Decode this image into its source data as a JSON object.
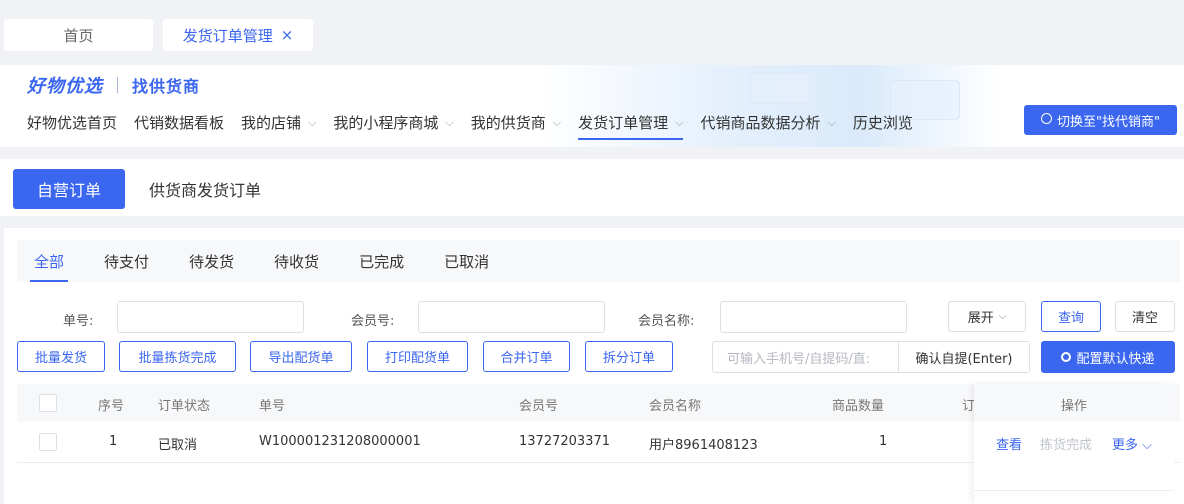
{
  "tabs": {
    "home": "首页",
    "active": "发货订单管理",
    "close": "×"
  },
  "brand": {
    "logo": "好物优选",
    "sub": "找供货商"
  },
  "nav": [
    {
      "label": "好物优选首页",
      "chevron": ""
    },
    {
      "label": "代销数据看板",
      "chevron": ""
    },
    {
      "label": "我的店铺",
      "chevron": "⌵"
    },
    {
      "label": "我的小程序商城",
      "chevron": "⌵"
    },
    {
      "label": "我的供货商",
      "chevron": "⌵"
    },
    {
      "label": "发货订单管理",
      "chevron": "⌵"
    },
    {
      "label": "代销商品数据分析",
      "chevron": "⌵"
    },
    {
      "label": "历史浏览",
      "chevron": ""
    }
  ],
  "switch_button": "切换至\"找代销商\"",
  "order_types": {
    "self": "自营订单",
    "supplier": "供货商发货订单"
  },
  "status_tabs": [
    "全部",
    "待支付",
    "待发货",
    "待收货",
    "已完成",
    "已取消"
  ],
  "filters": {
    "order_no_label": "单号:",
    "member_no_label": "会员号:",
    "member_name_label": "会员名称:",
    "expand": "展开",
    "query": "查询",
    "clear": "清空"
  },
  "actions": {
    "batch_ship": "批量发货",
    "batch_pick": "批量拣货完成",
    "export": "导出配货单",
    "print": "打印配货单",
    "merge": "合并订单",
    "split": "拆分订单",
    "scan_placeholder": "可输入手机号/自提码/直:",
    "confirm_pickup": "确认自提(Enter)",
    "config_express": "配置默认快递"
  },
  "table": {
    "headers": {
      "seq": "序号",
      "status": "订单状态",
      "order_no": "单号",
      "member_no": "会员号",
      "member_name": "会员名称",
      "qty": "商品数量",
      "truncated": "订",
      "ops": "操作"
    },
    "rows": [
      {
        "seq": "1",
        "status": "已取消",
        "order_no": "W100001231208000001",
        "member_no": "13727203371",
        "member_name": "用户8961408123",
        "qty": "1"
      }
    ],
    "ops": {
      "view": "查看",
      "pick": "拣货完成",
      "more": "更多 ⌵"
    }
  },
  "colors": {
    "primary": "#3a66f0",
    "muted": "#c0c4cc"
  }
}
